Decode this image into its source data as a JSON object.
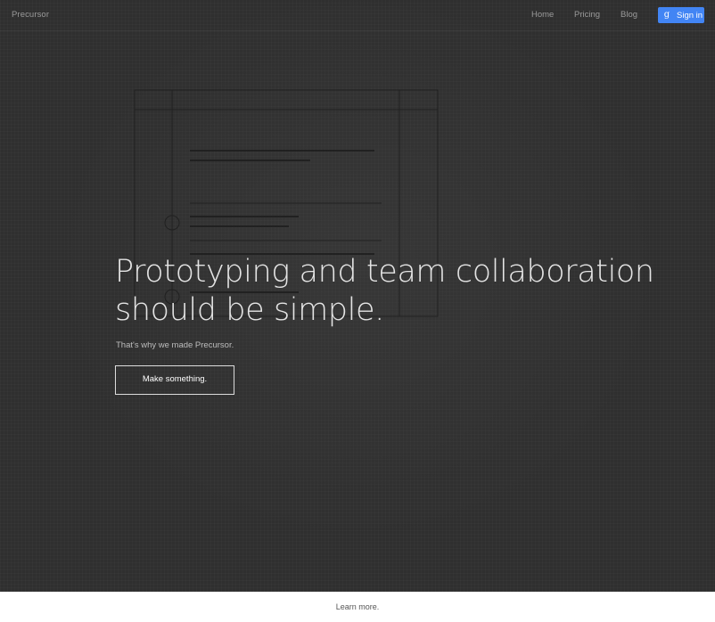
{
  "nav": {
    "brand": "Precursor",
    "links": [
      {
        "label": "Home"
      },
      {
        "label": "Pricing"
      },
      {
        "label": "Blog"
      }
    ],
    "signin_icon": "google-plus-icon",
    "signin_icon_glyph": "g",
    "signin_label": "Sign in"
  },
  "hero": {
    "headline_line1": "Prototyping and team collaboration",
    "headline_line2": "should be simple.",
    "subtext": "That's why we made Precursor.",
    "cta_label": "Make something."
  },
  "footer": {
    "learn_more": "Learn more."
  },
  "colors": {
    "background": "#2f2f2f",
    "signin_button": "#4285f4",
    "text_light": "#e4e4e4",
    "footer_bg": "#ffffff"
  }
}
